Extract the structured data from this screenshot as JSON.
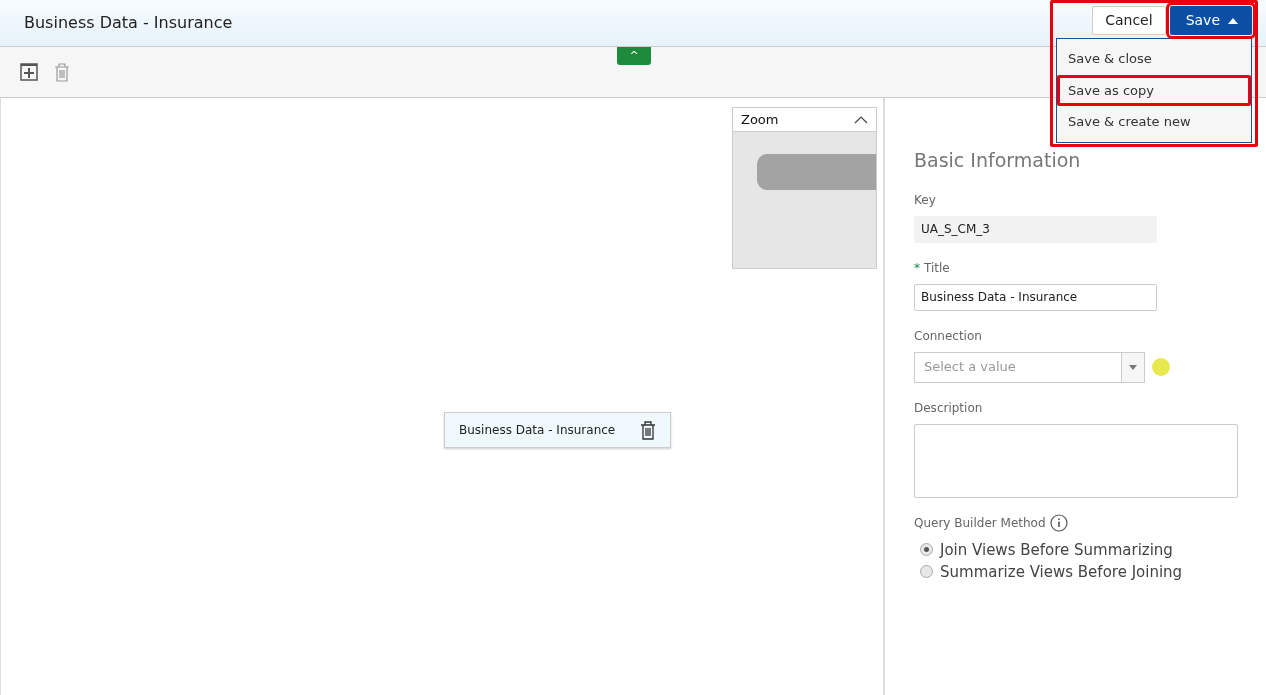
{
  "header": {
    "title": "Business Data - Insurance",
    "cancel_label": "Cancel",
    "save_label": "Save",
    "save_highlighted": true,
    "menu_expanded": true,
    "menu_highlighted": true
  },
  "save_menu": [
    {
      "label": "Save & close",
      "highlighted": false
    },
    {
      "label": "Save as copy",
      "highlighted": true
    },
    {
      "label": "Save & create new",
      "highlighted": false
    }
  ],
  "toolbar": {
    "collapse_label": "^"
  },
  "zoom_panel": {
    "title": "Zoom",
    "expanded": true
  },
  "canvas": {
    "nodes": [
      {
        "label": "Business Data - Insurance"
      }
    ]
  },
  "form": {
    "heading": "Basic Information",
    "key": {
      "label": "Key",
      "value": "UA_S_CM_3"
    },
    "title": {
      "label": "Title",
      "required": true,
      "required_mark": "*",
      "value": "Business Data - Insurance"
    },
    "connection": {
      "label": "Connection",
      "placeholder": "Select a value"
    },
    "description": {
      "label": "Description"
    },
    "method": {
      "label": "Query Builder Method",
      "options": [
        {
          "label": "Join Views Before Summarizing",
          "selected": true
        },
        {
          "label": "Summarize Views Before Joining",
          "selected": false
        }
      ]
    }
  }
}
